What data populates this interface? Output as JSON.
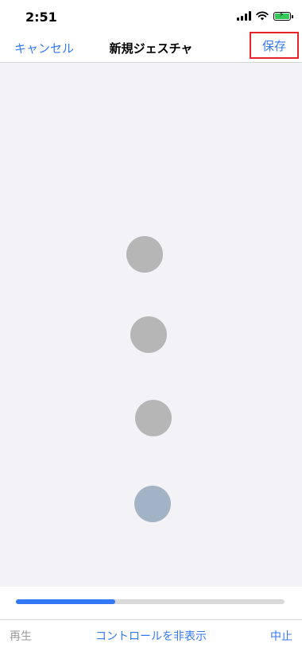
{
  "status_bar": {
    "time": "2:51"
  },
  "navbar": {
    "cancel_label": "キャンセル",
    "title": "新規ジェスチャ",
    "save_label": "保存"
  },
  "gesture": {
    "touch_points": [
      {
        "id": 1,
        "state": "recorded"
      },
      {
        "id": 2,
        "state": "recorded"
      },
      {
        "id": 3,
        "state": "recorded"
      },
      {
        "id": 4,
        "state": "current"
      }
    ]
  },
  "timeline": {
    "progress": 0.37
  },
  "toolbar": {
    "play_label": "再生",
    "hide_controls_label": "コントロールを非表示",
    "stop_label": "中止"
  },
  "colors": {
    "accent": "#3478f6",
    "highlight_border": "#e8232a",
    "touch_recorded": "#b6b6b6",
    "touch_current": "#a3b3c6",
    "canvas_bg": "#f2f2f7"
  }
}
